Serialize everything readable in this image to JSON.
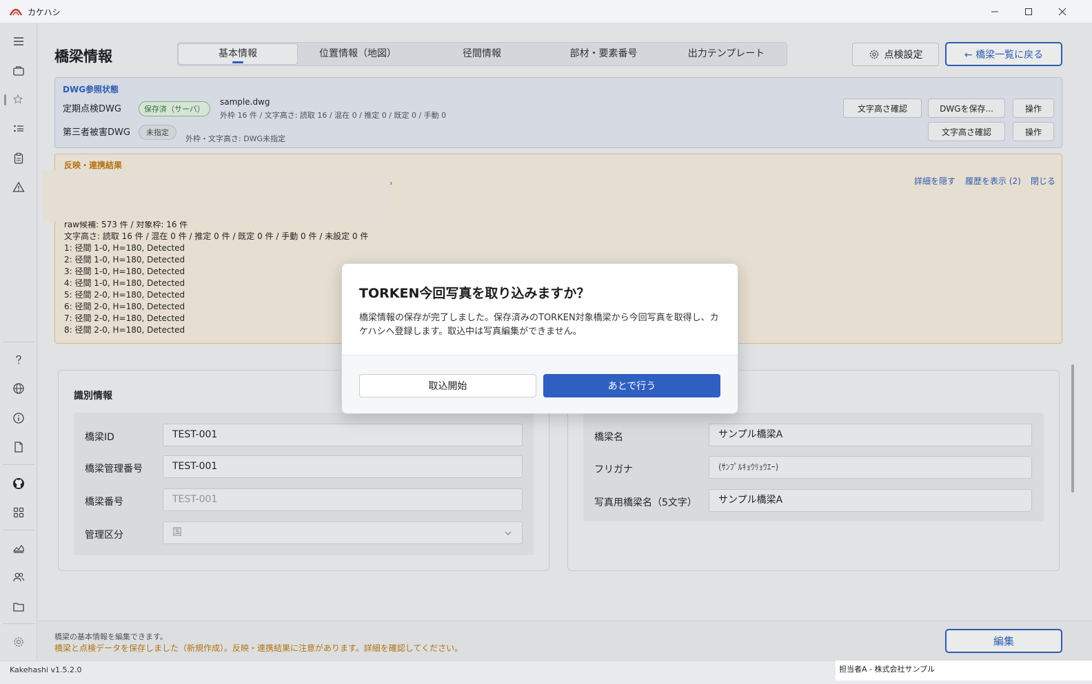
{
  "window": {
    "title": "カケハシ"
  },
  "header": {
    "page_title": "橋梁情報",
    "tabs": [
      "基本情報",
      "位置情報（地図）",
      "径間情報",
      "部材・要素番号",
      "出力テンプレート"
    ],
    "settings_button": "点検設定",
    "back_button": "← 橋梁一覧に戻る"
  },
  "dwg": {
    "heading": "DWG参照状態",
    "periodic": {
      "label": "定期点検DWG",
      "status": "保存済（サーバ）",
      "filename": "sample.dwg",
      "detail": "外枠 16 件 / 文字高さ: 読取 16 / 混在 0 / 推定 0 / 既定 0 / 手動 0"
    },
    "third": {
      "label": "第三者被害DWG",
      "status": "未指定",
      "detail": "外枠・文字高さ: DWG未指定"
    },
    "buttons": {
      "check_height": "文字高さ確認",
      "save_dwg": "DWGを保存...",
      "operate": "操作"
    }
  },
  "result": {
    "heading": "反映・連携結果",
    "trailing_mark": "。",
    "links": {
      "hide": "詳細を隠す",
      "history": "履歴を表示 (2)",
      "close": "閉じる"
    },
    "lines": [
      "raw候補: 573 件 / 対象枠: 16 件",
      "文字高さ: 読取 16 件 / 混在 0 件 / 推定 0 件 / 既定 0 件 / 手動 0 件 / 未設定 0 件",
      "1: 径間 1-0, H=180, Detected",
      "2: 径間 1-0, H=180, Detected",
      "3: 径間 1-0, H=180, Detected",
      "4: 径間 1-0, H=180, Detected",
      "5: 径間 2-0, H=180, Detected",
      "6: 径間 2-0, H=180, Detected",
      "7: 径間 2-0, H=180, Detected",
      "8: 径間 2-0, H=180, Detected"
    ]
  },
  "ident": {
    "title": "識別情報",
    "bridge_id": {
      "label": "橋梁ID",
      "value": "TEST-001"
    },
    "mgmt_no": {
      "label": "橋梁管理番号",
      "value": "TEST-001"
    },
    "bridge_no": {
      "label": "橋梁番号",
      "value": "TEST-001"
    },
    "category": {
      "label": "管理区分",
      "value": "国"
    }
  },
  "names": {
    "name": {
      "label": "橋梁名",
      "value": "サンプル橋梁A"
    },
    "kana": {
      "label": "フリガナ",
      "value": "(ｻﾝﾌﾟﾙｷｮｳﾘｮｳｴｰ)"
    },
    "photo_name": {
      "label": "写真用橋梁名（5文字）",
      "value": "サンプル橋梁A"
    }
  },
  "footer": {
    "hint": "橋梁の基本情報を編集できます。",
    "warning": "橋梁と点検データを保存しました（新規作成）。反映・連携結果に注意があります。詳細を確認してください。",
    "edit_button": "編集"
  },
  "status": {
    "version": "Kakehashi v1.5.2.0",
    "user": "担当者A - 株式会社サンプル"
  },
  "dialog": {
    "title": "TORKEN今回写真を取り込みますか？",
    "message": "橋梁情報の保存が完了しました。保存済みのTORKEN対象橋梁から今回写真を取得し、カケハシへ登録します。取込中は写真編集ができません。",
    "start_button": "取込開始",
    "later_button": "あとで行う"
  },
  "colors": {
    "accent": "#2f5fc0",
    "warning": "#c27a12",
    "success": "#2e7d32"
  }
}
